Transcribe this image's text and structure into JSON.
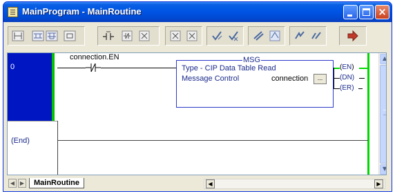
{
  "window": {
    "title": "MainProgram - MainRoutine",
    "controls": {
      "minimize": "minimize",
      "maximize": "maximize",
      "close": "×"
    }
  },
  "toolbar": {
    "icons": [
      "rung-icon",
      "branch-icon",
      "branch-level-icon",
      "xic-contact-icon",
      "xio-contact-icon",
      "ote-coil-icon",
      "otl-coil-icon",
      "otu-coil-icon",
      "ons-icon",
      "osr-icon",
      "osf-icon",
      "new-rung-icon",
      "delete-icon",
      "go-to-icon"
    ]
  },
  "ladder": {
    "rungs": [
      {
        "number": "0",
        "contact_tag": "connection.EN",
        "instruction": {
          "name": "MSG",
          "type_line": "Type - CIP Data Table Read",
          "control_label": "Message Control",
          "control_value": "connection",
          "ellipsis": "..."
        },
        "flags": [
          "EN",
          "DN",
          "ER"
        ]
      }
    ],
    "end_label": "(End)"
  },
  "tabs": [
    {
      "label": "MainRoutine"
    }
  ],
  "colors": {
    "rung_selected": "#0016c2",
    "power_rail": "#00d800",
    "instruction_text": "#1a2a8a",
    "titlebar": "#0055e5"
  }
}
